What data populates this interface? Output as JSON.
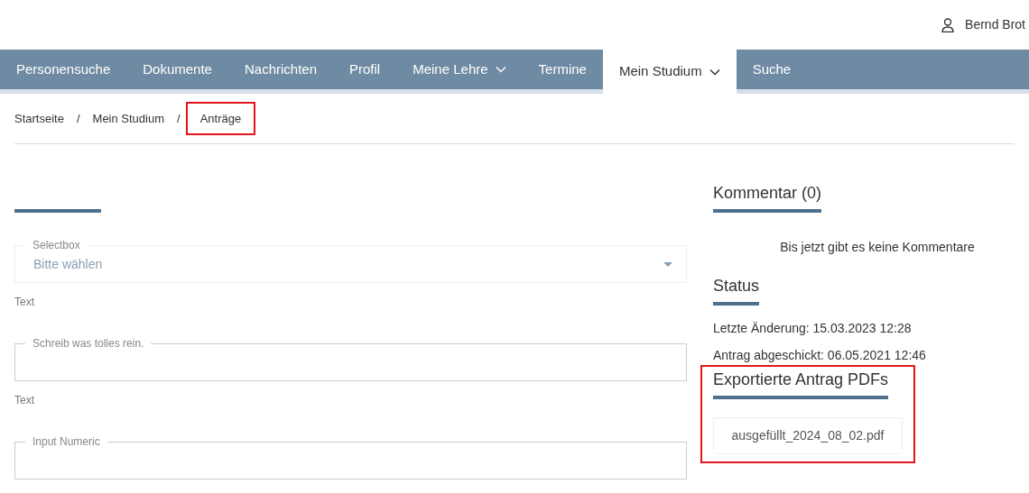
{
  "user": {
    "name": "Bernd Brot"
  },
  "nav": [
    {
      "label": "Personensuche",
      "selected": false,
      "dropdown": false
    },
    {
      "label": "Dokumente",
      "selected": false,
      "dropdown": false
    },
    {
      "label": "Nachrichten",
      "selected": false,
      "dropdown": false
    },
    {
      "label": "Profil",
      "selected": false,
      "dropdown": false
    },
    {
      "label": "Meine Lehre",
      "selected": false,
      "dropdown": true
    },
    {
      "label": "Termine",
      "selected": false,
      "dropdown": false
    },
    {
      "label": "Mein Studium",
      "selected": true,
      "dropdown": true
    },
    {
      "label": "Suche",
      "selected": false,
      "dropdown": false
    }
  ],
  "breadcrumb_separator": "/",
  "breadcrumb": [
    {
      "label": "Startseite",
      "highlighted": false
    },
    {
      "label": "Mein Studium",
      "highlighted": false
    },
    {
      "label": "Anträge",
      "highlighted": true
    }
  ],
  "form": {
    "fields": [
      {
        "kind": "select",
        "label": "Selectbox",
        "placeholder": "Bitte wählen",
        "hint": "Text"
      },
      {
        "kind": "text",
        "label": "Schreib was tolles rein.",
        "hint": "Text"
      },
      {
        "kind": "text",
        "label": "Input Numeric"
      }
    ]
  },
  "comments": {
    "title": "Kommentar (0)",
    "empty": "Bis jetzt gibt es keine Kommentare"
  },
  "status": {
    "title": "Status",
    "lines": [
      "Letzte Änderung: 15.03.2023 12:28",
      "Antrag abgeschickt: 06.05.2021 12:46"
    ]
  },
  "pdfs": {
    "title": "Exportierte Antrag PDFs",
    "highlighted": true,
    "files": [
      "ausgefüllt_2024_08_02.pdf"
    ]
  }
}
